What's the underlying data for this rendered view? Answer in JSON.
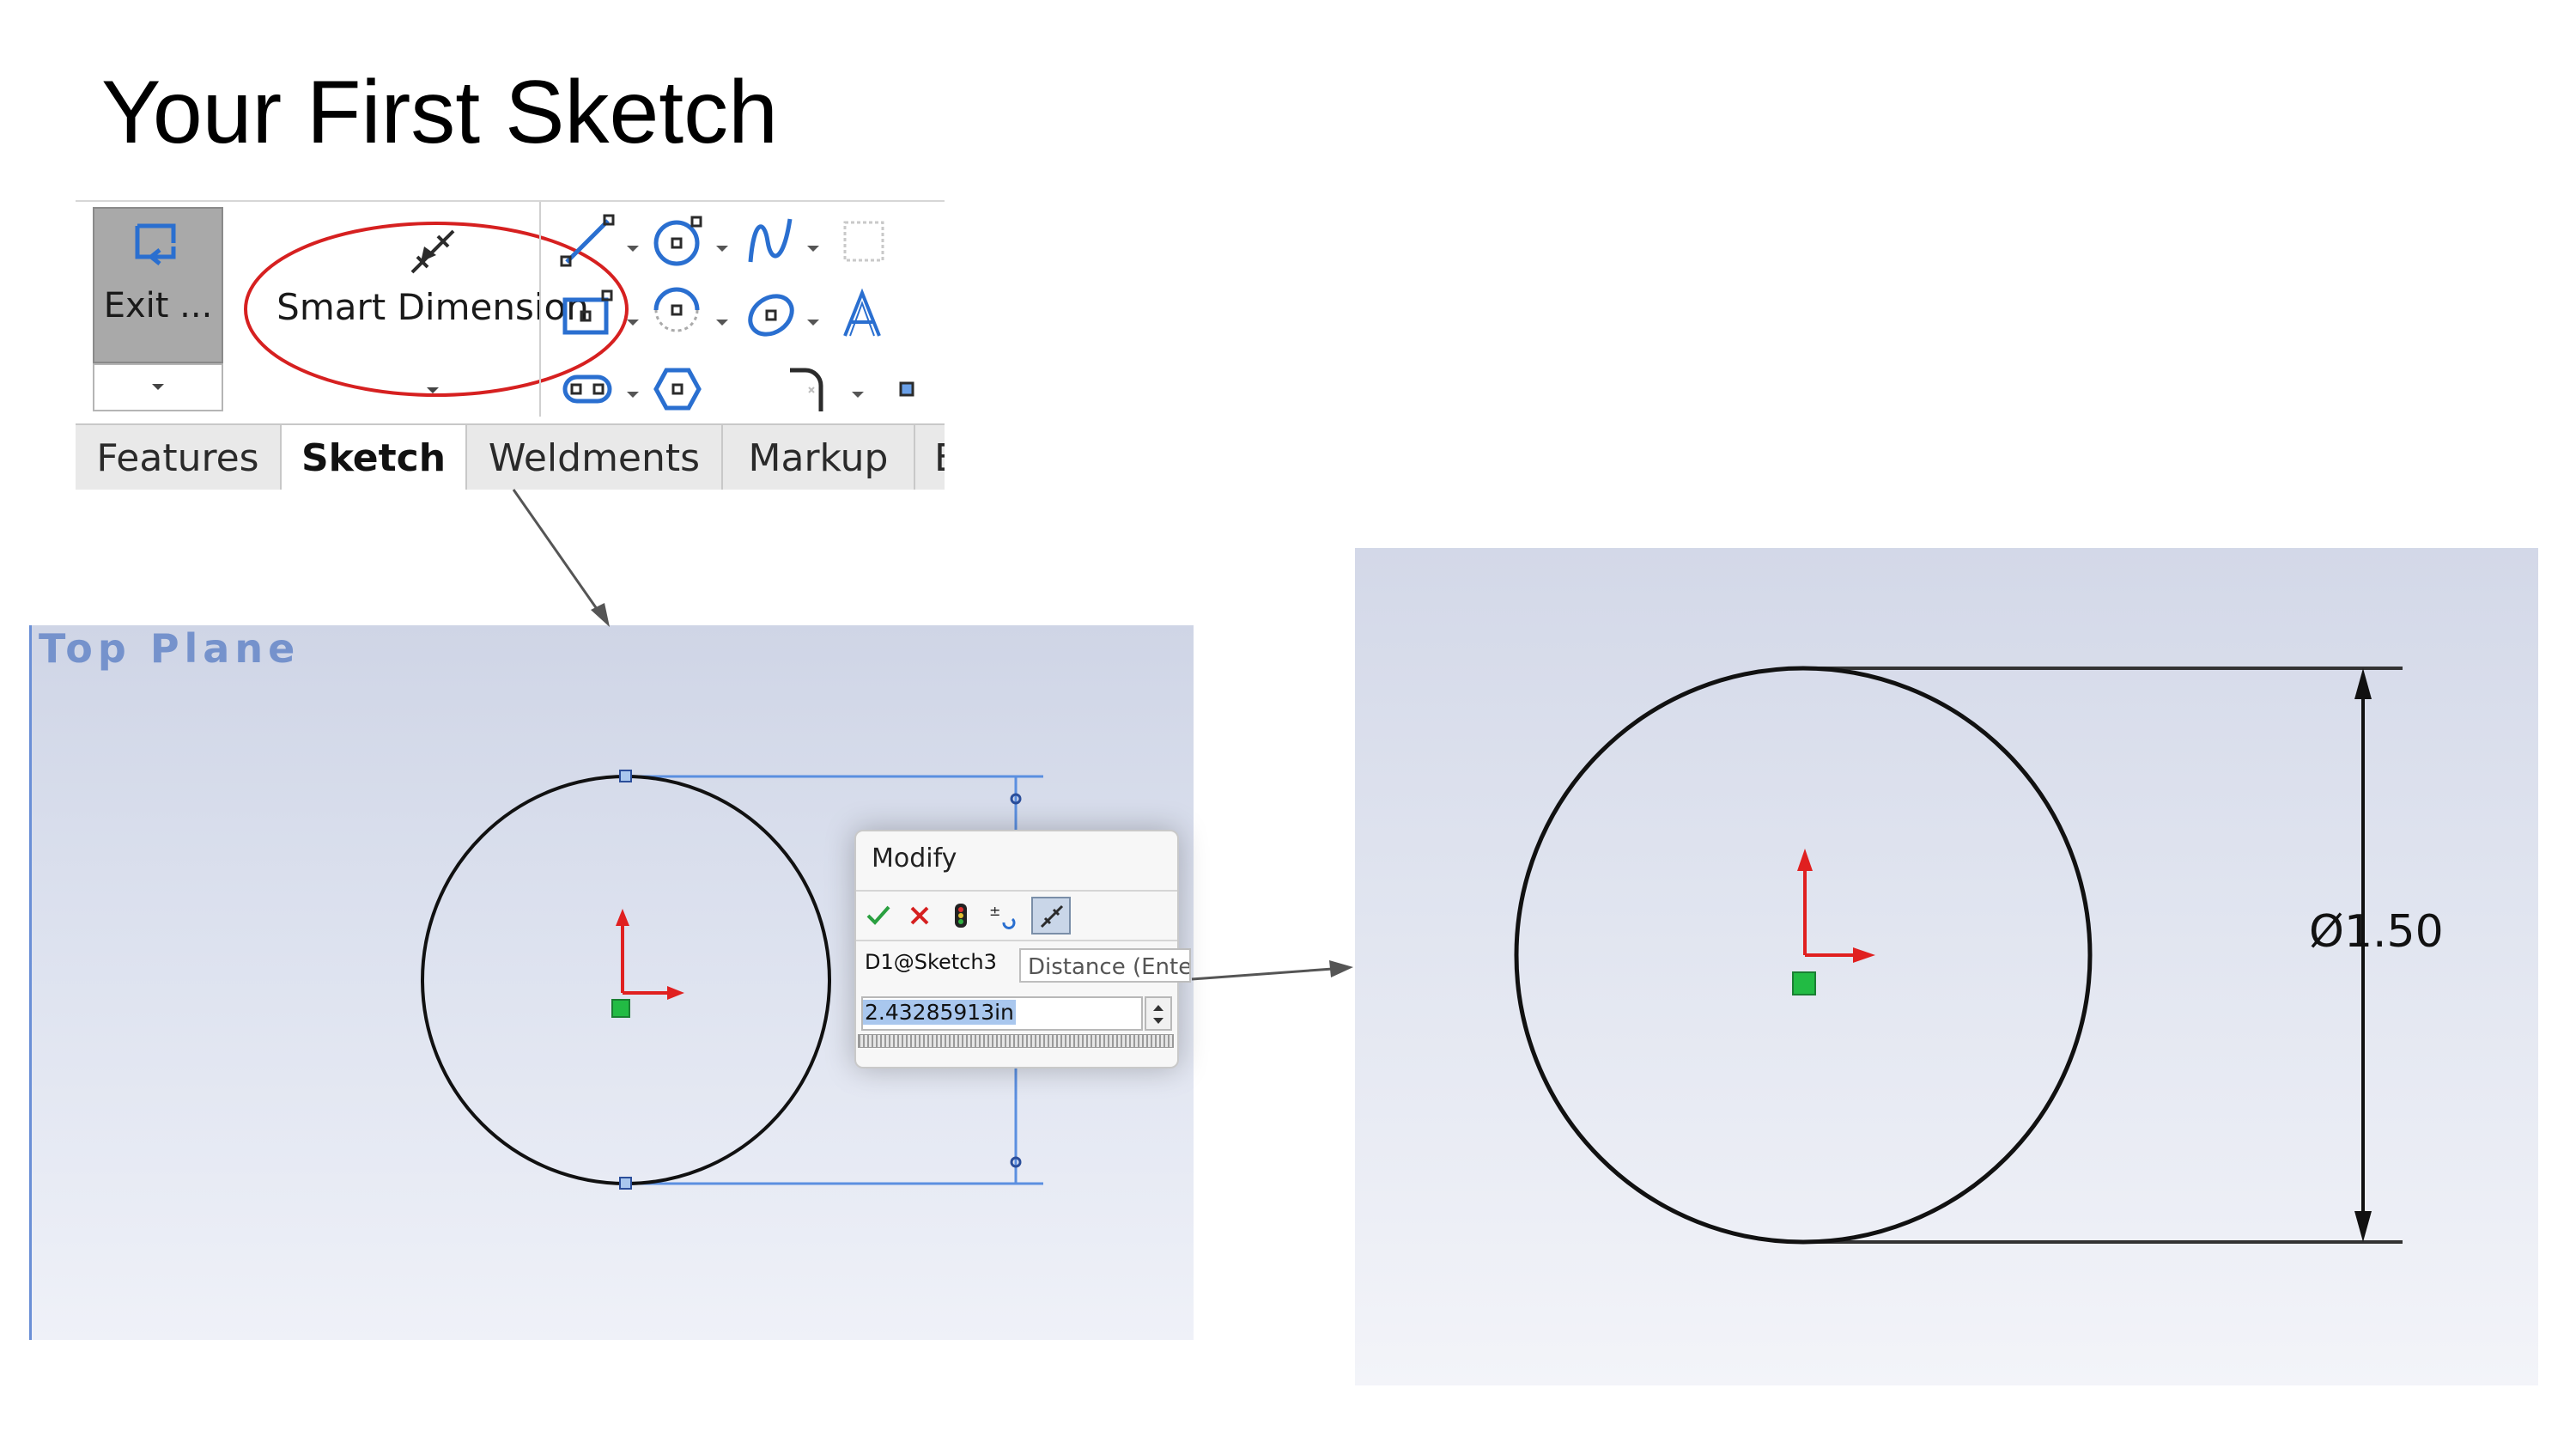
{
  "slide_title": "Your First Sketch",
  "ribbon": {
    "exit_label": "Exit ...",
    "smart_dimension_label": "Smart Dimension",
    "tools": [
      "line-icon",
      "circle-icon",
      "spline-icon",
      "construction-geometry-icon",
      "rectangle-icon",
      "arc-icon",
      "ellipse-icon",
      "text-icon",
      "slot-icon",
      "polygon-icon",
      "fillet-icon",
      "point-icon"
    ],
    "tabs": [
      "Features",
      "Sketch",
      "Weldments",
      "Markup",
      "E"
    ],
    "active_tab": "Sketch",
    "highlight_color": "#d62020"
  },
  "left_view": {
    "plane_label": "Top Plane",
    "modify_dialog": {
      "title": "Modify",
      "dimension_name": "D1@Sketch3",
      "tooltip": "Distance (Enter",
      "value": "2.43285913in"
    }
  },
  "right_view": {
    "dimension_label": "1.50",
    "diameter_symbol": "Ø"
  },
  "colors": {
    "sketch_line": "#111111",
    "dimension_line": "#5b8fe0",
    "origin_arrow": "#e02020",
    "origin_point": "#22bb44"
  }
}
